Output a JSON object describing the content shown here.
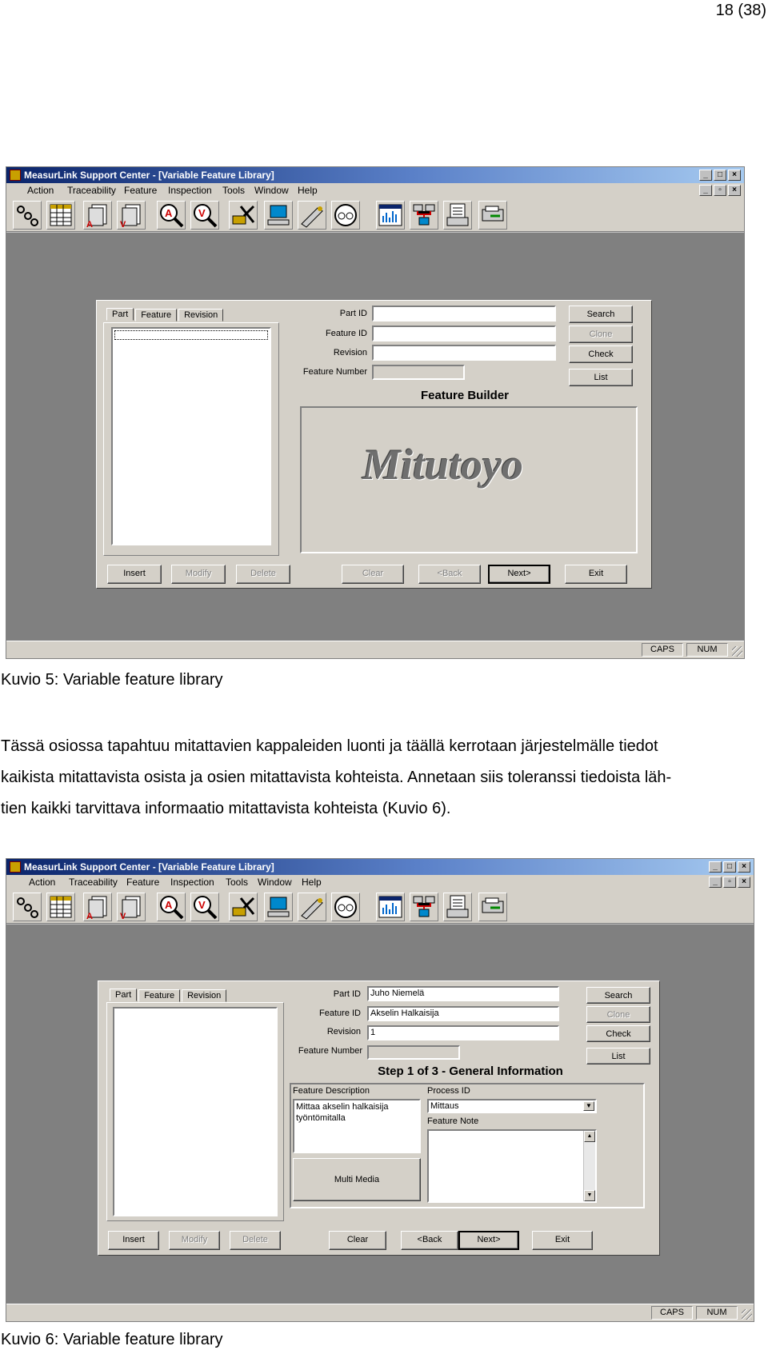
{
  "page_number": "18 (38)",
  "app_title": "MeasurLink Support Center - [Variable Feature Library]",
  "menu": [
    "Action",
    "Traceability",
    "Feature",
    "Inspection",
    "Tools",
    "Window",
    "Help"
  ],
  "toolbar_icons": [
    "connect-icon",
    "table-icon",
    "attribute-icon",
    "variable-icon",
    "inspect-attribute-icon",
    "inspect-variable-icon",
    "tools-icon",
    "computer-icon",
    "gauge-probe-icon",
    "dial-icon",
    "chart-icon",
    "network-icon",
    "report-icon",
    "export-icon"
  ],
  "status": {
    "caps": "CAPS",
    "num": "NUM"
  },
  "tabs": [
    "Part",
    "Feature",
    "Revision"
  ],
  "labels": {
    "part_id": "Part ID",
    "feature_id": "Feature ID",
    "revision": "Revision",
    "feature_number": "Feature Number"
  },
  "side_buttons": {
    "search": "Search",
    "clone": "Clone",
    "check": "Check",
    "list": "List"
  },
  "bottom_buttons": {
    "insert": "Insert",
    "modify": "Modify",
    "delete": "Delete",
    "clear": "Clear",
    "back": "<Back",
    "next": "Next>",
    "exit": "Exit"
  },
  "figure1": {
    "heading": "Feature Builder",
    "logo": "Mitutoyo",
    "caption": "Kuvio 5: Variable feature library"
  },
  "paragraph": [
    "Tässä osiossa tapahtuu mitattavien kappaleiden luonti ja täällä kerrotaan järjestelmälle tiedot",
    "kaikista mitattavista osista ja osien mitattavista kohteista. Annetaan siis toleranssi tiedoista läh-",
    "tien kaikki tarvittava informaatio mitattavista kohteista (Kuvio 6)."
  ],
  "figure2": {
    "part_id": "Juho Niemelä",
    "feature_id": "Akselin Halkaisija",
    "revision": "1",
    "heading": "Step 1 of 3 - General Information",
    "feature_description_label": "Feature Description",
    "feature_description": [
      "Mittaa akselin halkaisija",
      "työntömitalla"
    ],
    "process_id_label": "Process ID",
    "process_id": "Mittaus",
    "feature_note_label": "Feature Note",
    "multimedia": "Multi Media",
    "caption": "Kuvio 6: Variable feature library"
  }
}
